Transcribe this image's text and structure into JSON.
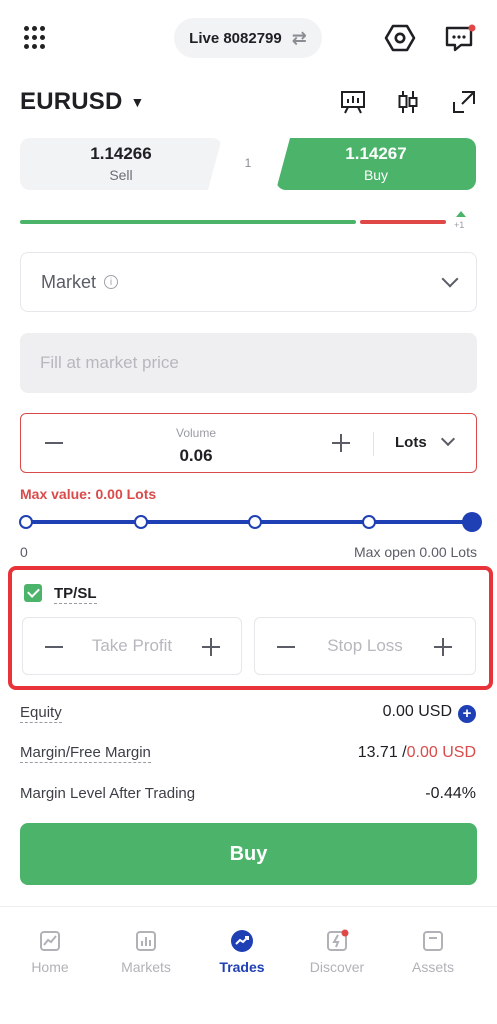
{
  "header": {
    "account": "Live 8082799",
    "swap_icon": "⇄"
  },
  "symbol": {
    "name": "EURUSD",
    "caret": "▼"
  },
  "quote": {
    "sell_price": "1.14266",
    "sell_label": "Sell",
    "spread": "1",
    "buy_price": "1.14267",
    "buy_label": "Buy",
    "sentiment_plus": "+1"
  },
  "order_type": {
    "label": "Market",
    "info": "i"
  },
  "fill": {
    "placeholder": "Fill at market price"
  },
  "volume": {
    "label": "Volume",
    "value": "0.06",
    "unit": "Lots",
    "max_value": "Max value: 0.00 Lots"
  },
  "slider": {
    "min_label": "0",
    "max_label": "Max open 0.00 Lots"
  },
  "tpsl": {
    "label": "TP/SL",
    "checked": true,
    "take_profit": "Take Profit",
    "stop_loss": "Stop Loss"
  },
  "info": {
    "equity_label": "Equity",
    "equity_value": "0.00 USD",
    "margin_label": "Margin/Free Margin",
    "margin_value": "13.71 /",
    "free_margin_value": "0.00 USD",
    "level_label": "Margin Level After Trading",
    "level_value": "-0.44%"
  },
  "buy_button": "Buy",
  "nav": {
    "items": [
      {
        "label": "Home"
      },
      {
        "label": "Markets"
      },
      {
        "label": "Trades"
      },
      {
        "label": "Discover"
      },
      {
        "label": "Assets"
      }
    ]
  },
  "colors": {
    "buy_green": "#4cb46a",
    "sell_red": "#e04848",
    "accent_blue": "#1f3fb5",
    "highlight_red": "#e8333a"
  }
}
